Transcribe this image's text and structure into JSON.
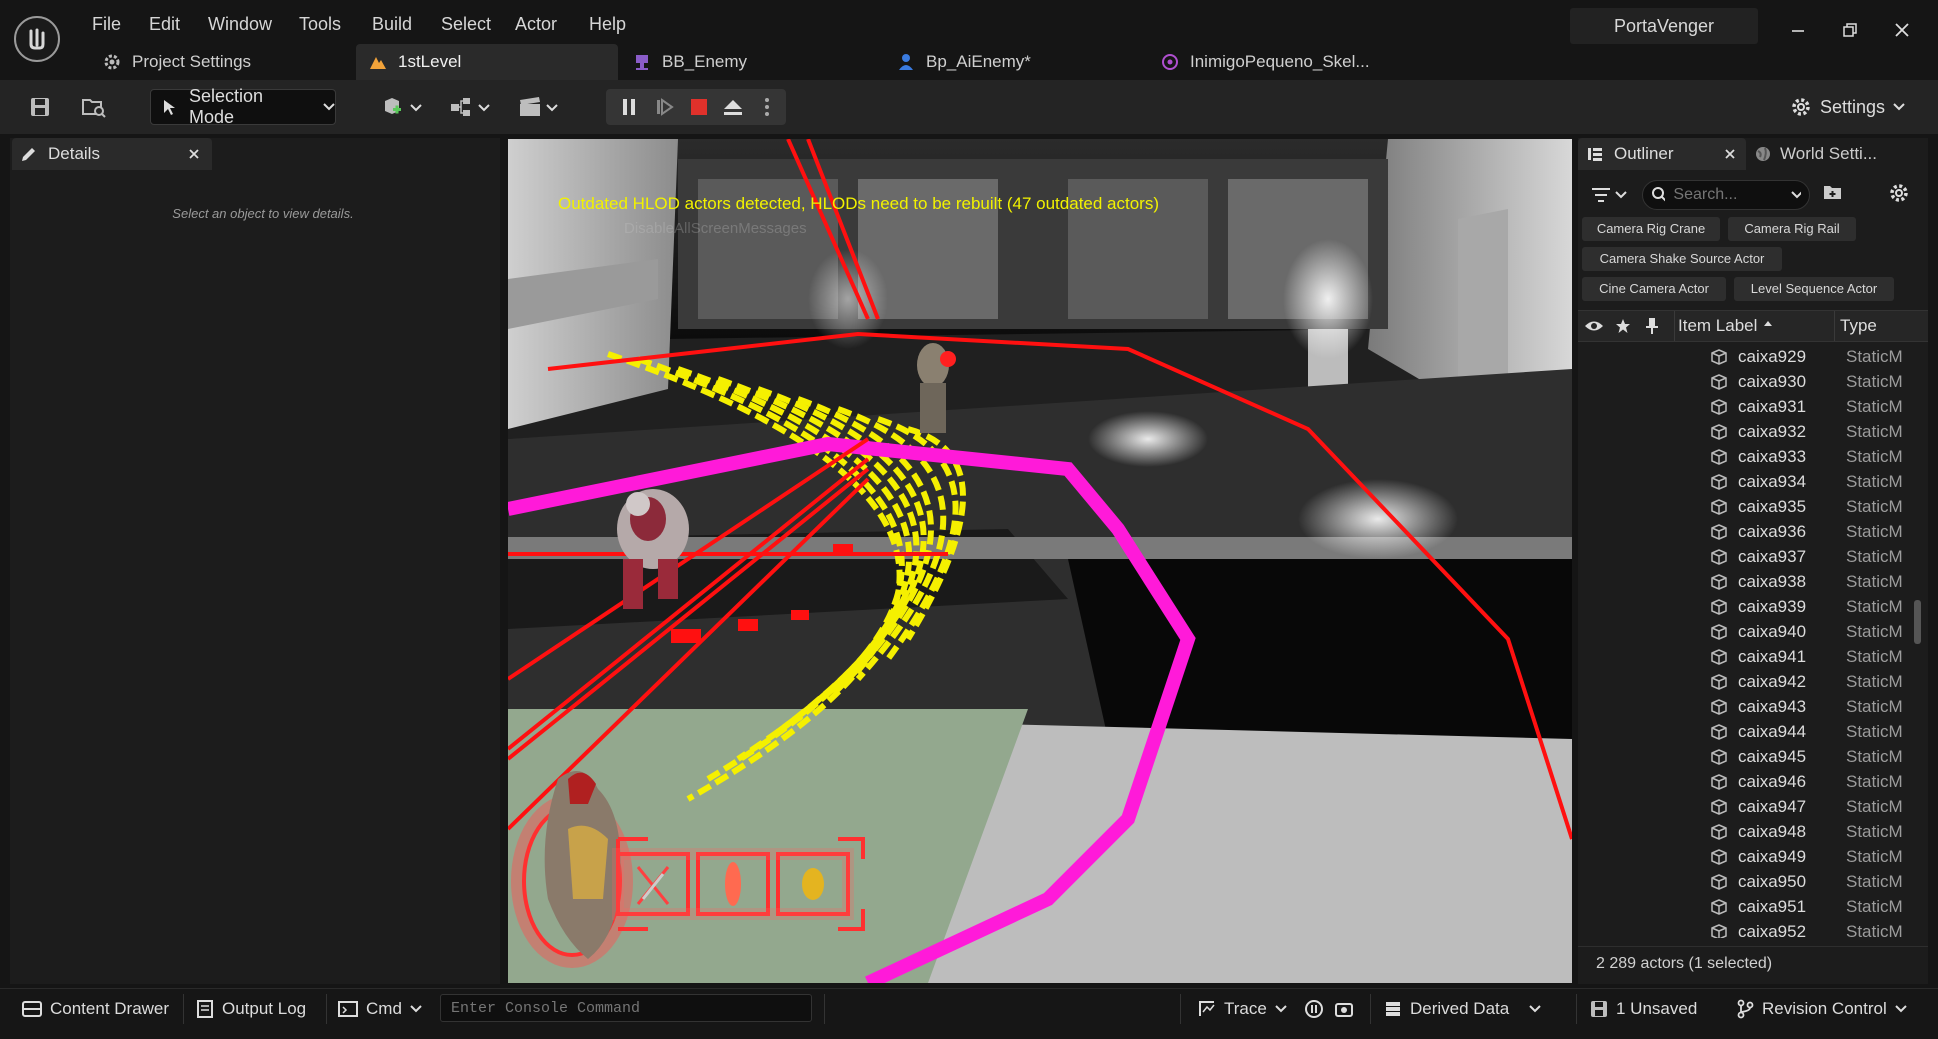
{
  "menu": [
    "File",
    "Edit",
    "Window",
    "Tools",
    "Build",
    "Select",
    "Actor",
    "Help"
  ],
  "project_name": "PortaVenger",
  "tabs": [
    {
      "label": "Project Settings",
      "icon": "gear-icon",
      "active": false
    },
    {
      "label": "1stLevel",
      "icon": "level-icon",
      "active": true
    },
    {
      "label": "BB_Enemy",
      "icon": "blackboard-icon",
      "active": false
    },
    {
      "label": "Bp_AiEnemy*",
      "icon": "blueprint-icon",
      "active": false
    },
    {
      "label": "InimigoPequeno_Skel...",
      "icon": "skeleton-icon",
      "active": false
    }
  ],
  "toolbar": {
    "selection_mode": "Selection Mode",
    "settings": "Settings"
  },
  "details": {
    "title": "Details",
    "empty_message": "Select an object to view details."
  },
  "viewport": {
    "hlod_message": "Outdated HLOD actors detected, HLODs need to be rebuilt (47 outdated actors)",
    "disable_message": "DisableAllScreenMessages"
  },
  "outliner": {
    "title": "Outliner",
    "world_settings_tab": "World Setti...",
    "search_placeholder": "Search...",
    "quick_add": [
      "Camera Rig Crane",
      "Camera Rig Rail",
      "Camera Shake Source Actor",
      "Cine Camera Actor",
      "Level Sequence Actor"
    ],
    "columns": {
      "label": "Item Label",
      "type": "Type"
    },
    "rows": [
      {
        "label": "caixa929",
        "type": "StaticM"
      },
      {
        "label": "caixa930",
        "type": "StaticM"
      },
      {
        "label": "caixa931",
        "type": "StaticM"
      },
      {
        "label": "caixa932",
        "type": "StaticM"
      },
      {
        "label": "caixa933",
        "type": "StaticM"
      },
      {
        "label": "caixa934",
        "type": "StaticM"
      },
      {
        "label": "caixa935",
        "type": "StaticM"
      },
      {
        "label": "caixa936",
        "type": "StaticM"
      },
      {
        "label": "caixa937",
        "type": "StaticM"
      },
      {
        "label": "caixa938",
        "type": "StaticM"
      },
      {
        "label": "caixa939",
        "type": "StaticM"
      },
      {
        "label": "caixa940",
        "type": "StaticM"
      },
      {
        "label": "caixa941",
        "type": "StaticM"
      },
      {
        "label": "caixa942",
        "type": "StaticM"
      },
      {
        "label": "caixa943",
        "type": "StaticM"
      },
      {
        "label": "caixa944",
        "type": "StaticM"
      },
      {
        "label": "caixa945",
        "type": "StaticM"
      },
      {
        "label": "caixa946",
        "type": "StaticM"
      },
      {
        "label": "caixa947",
        "type": "StaticM"
      },
      {
        "label": "caixa948",
        "type": "StaticM"
      },
      {
        "label": "caixa949",
        "type": "StaticM"
      },
      {
        "label": "caixa950",
        "type": "StaticM"
      },
      {
        "label": "caixa951",
        "type": "StaticM"
      },
      {
        "label": "caixa952",
        "type": "StaticM"
      }
    ],
    "footer": "2 289 actors (1 selected)"
  },
  "statusbar": {
    "content_drawer": "Content Drawer",
    "output_log": "Output Log",
    "cmd": "Cmd",
    "console_placeholder": "Enter Console Command",
    "trace": "Trace",
    "derived_data": "Derived Data",
    "unsaved": "1 Unsaved",
    "revision_control": "Revision Control"
  },
  "colors": {
    "accent": "#f2a33a",
    "hlod_text": "#f2f200",
    "stop_red": "#e0312b",
    "debug_magenta": "#ff1ad9",
    "debug_red": "#ff1010",
    "debug_yellow": "#f5f000"
  }
}
